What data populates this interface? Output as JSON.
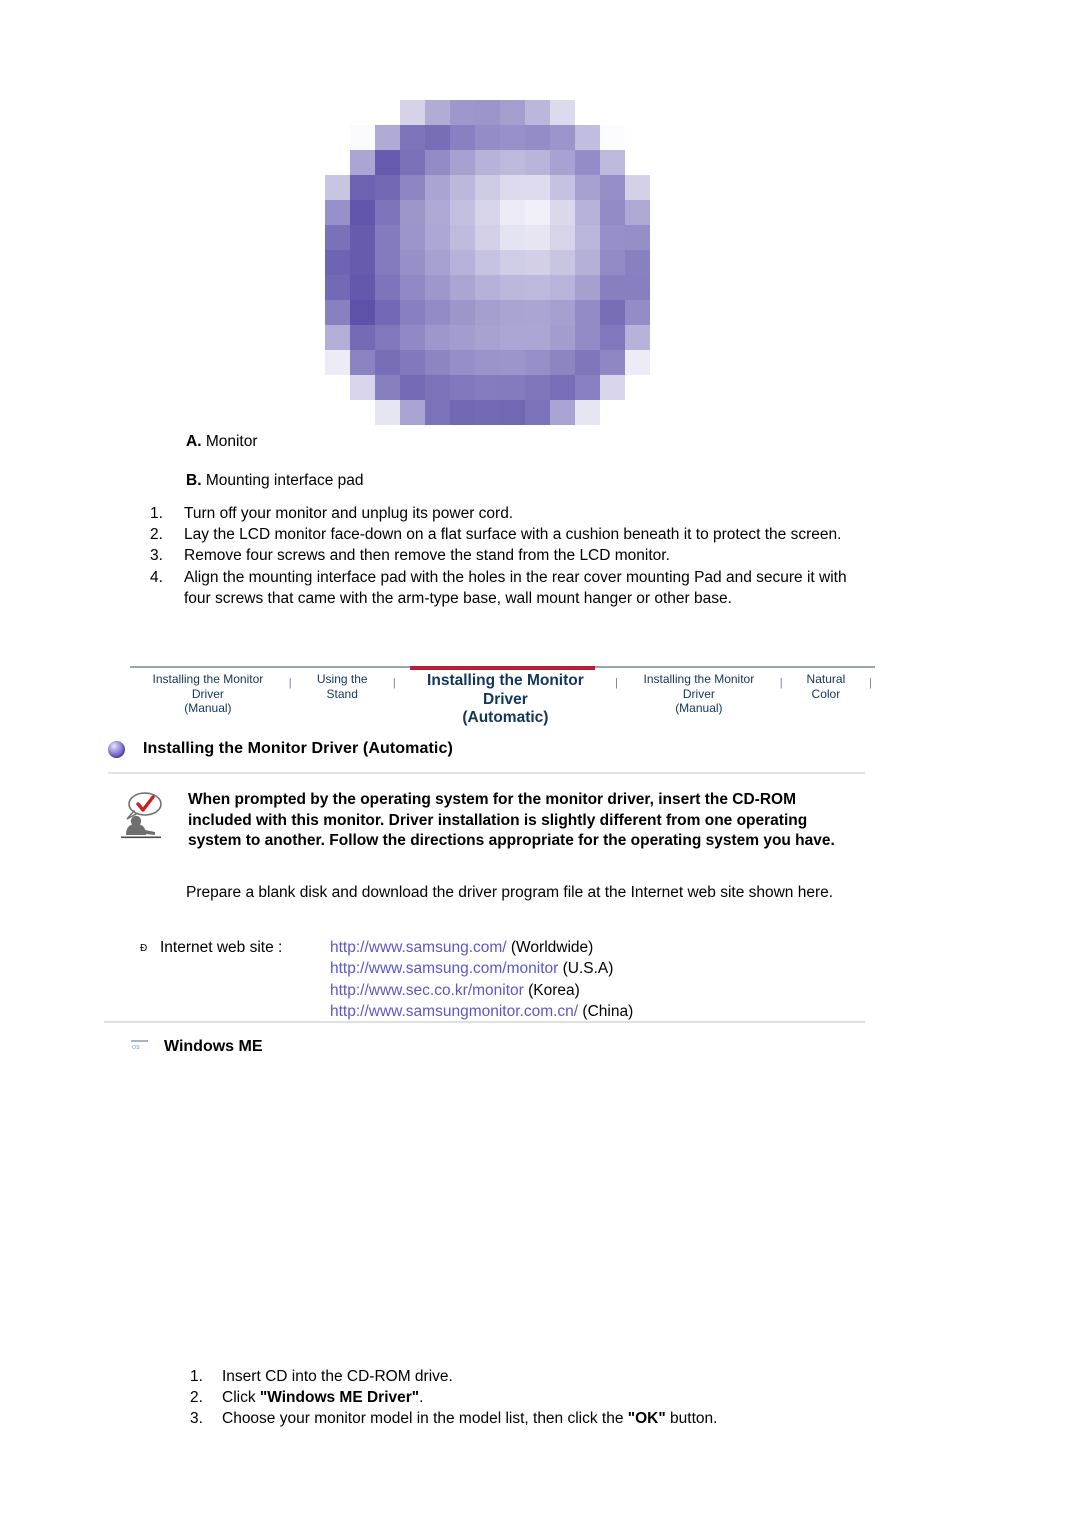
{
  "hero": {
    "icon_name": "pixelated-purple-sphere",
    "alt": "Pixelated purple sphere graphic"
  },
  "parts": [
    {
      "letter": "A.",
      "label": "Monitor"
    },
    {
      "letter": "B.",
      "label": "Mounting interface pad"
    }
  ],
  "steps_top": [
    {
      "num": "1.",
      "text": "Turn off your monitor and unplug its power cord."
    },
    {
      "num": "2.",
      "text": "Lay the LCD monitor face-down on a flat surface with a cushion beneath it to protect the screen."
    },
    {
      "num": "3.",
      "text": "Remove four screws and then remove the stand from the LCD monitor."
    },
    {
      "num": "4.",
      "text": "Align the mounting interface pad with the holes in the rear cover mounting Pad and secure it with four screws that came with the arm-type base, wall mount hanger or other base."
    }
  ],
  "tabnav": {
    "separator": "|",
    "active_accent_color": "#b61f35",
    "text_color": "#12355b",
    "items": [
      {
        "label": "Installing the Monitor Driver\n(Manual)",
        "active": false
      },
      {
        "label": "Using the Stand",
        "active": false
      },
      {
        "label": "Installing the Monitor Driver\n(Automatic)",
        "active": true
      },
      {
        "label": "Installing the Monitor Driver\n(Manual)",
        "active": false
      },
      {
        "label": "Natural Color",
        "active": false
      }
    ]
  },
  "section": {
    "bullet_icon": "purple-sphere-bullet",
    "title": "Installing the Monitor Driver (Automatic)"
  },
  "note": {
    "icon_name": "person-with-checkmark-note-icon",
    "text": "When prompted by the operating system for the monitor driver, insert the CD-ROM included with this monitor. Driver installation is slightly different from one operating system to another. Follow the directions appropriate for the operating system you have."
  },
  "prepare_paragraph": "Prepare a blank disk and download the driver program file at the Internet web site shown here.",
  "website": {
    "bullet": "Ð",
    "label": "Internet web site :",
    "link_color": "#5b57c8",
    "rows": [
      {
        "url": "http://www.samsung.com/",
        "region": " (Worldwide)"
      },
      {
        "url": "http://www.samsung.com/monitor",
        "region": " (U.S.A)"
      },
      {
        "url": "http://www.sec.co.kr/monitor",
        "region": " (Korea)"
      },
      {
        "url": "http://www.samsungmonitor.com.cn/",
        "region": " (China)"
      }
    ]
  },
  "os_section": {
    "icon_name": "windows-os-badge-icon",
    "icon_glyph": "OS",
    "title": "Windows ME"
  },
  "steps_bottom": [
    {
      "num": "1.",
      "pre": "Insert CD into the CD-ROM drive.",
      "bold": "",
      "post": ""
    },
    {
      "num": "2.",
      "pre": "Click ",
      "bold": "\"Windows ME Driver\"",
      "post": "."
    },
    {
      "num": "3.",
      "pre": "Choose your monitor model in the model list, then click the ",
      "bold": "\"OK\"",
      "post": " button."
    }
  ]
}
